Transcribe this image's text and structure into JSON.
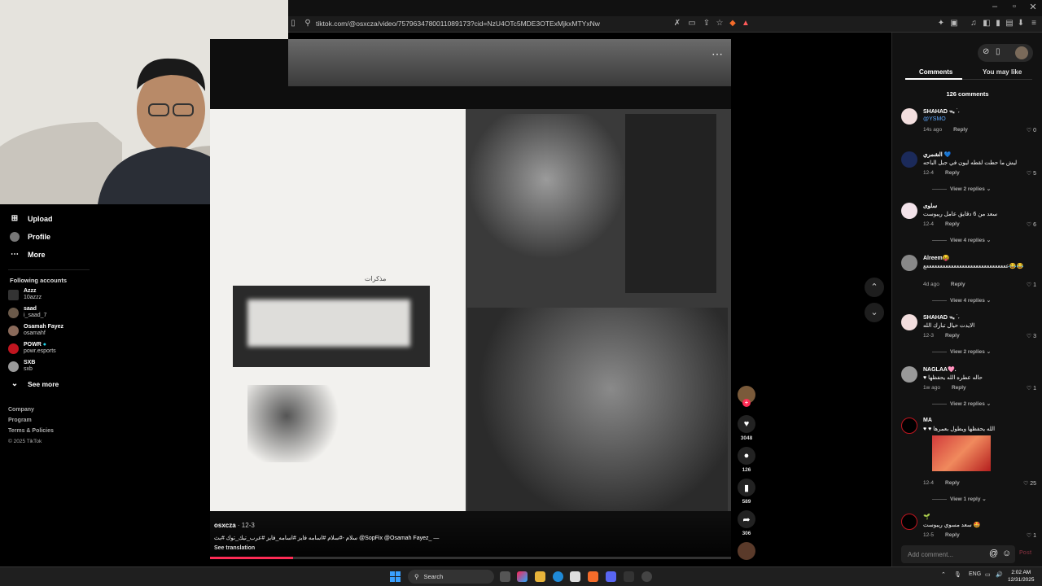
{
  "browser": {
    "url": "tiktok.com/@osxcza/video/7579634780011089173?cid=NzU4OTc5MDE3OTExMjkxMTYxNw",
    "window_controls": [
      "–",
      "▫",
      "✕"
    ]
  },
  "sidebar": {
    "nav": [
      {
        "label": "Upload",
        "icon": "plus-square-icon"
      },
      {
        "label": "Profile",
        "icon": "avatar-icon"
      },
      {
        "label": "More",
        "icon": "more-dots-icon"
      }
    ],
    "following_title": "Following accounts",
    "accounts": [
      {
        "name": "Azzz",
        "handle": "10azzz"
      },
      {
        "name": "saad",
        "handle": "i_saad_7"
      },
      {
        "name": "Osamah Fayez",
        "handle": "osamahf"
      },
      {
        "name": "POWR",
        "handle": "powr.esports",
        "verified": true
      },
      {
        "name": "SXB",
        "handle": "sxb"
      }
    ],
    "see_more": "See more",
    "footer": [
      "Company",
      "Program",
      "Terms & Policies",
      "© 2025 TikTok"
    ]
  },
  "video": {
    "author": "osxcza",
    "date": "· 12-3",
    "description": "سلام -#سلام #اسامه فايز #اسامه_فايز #عرب_تيك_توك #بث @SopFix @Osamah Fayez_ —",
    "see_translation": "See translation",
    "page_caption": "مذكرات",
    "progress": 0.16
  },
  "actions": {
    "likes": "3048",
    "comments": "126",
    "saves": "589",
    "shares": "306"
  },
  "panel": {
    "tabs": [
      "Comments",
      "You may like"
    ],
    "comments_count": "126 comments",
    "comments": [
      {
        "name": "SHAHAD ᯓ ࣪ ˖",
        "text": "@YSMO",
        "time": "14s ago",
        "likes": "0"
      },
      {
        "name": "الشمري 💙",
        "text": "ليش ما حطت لقطه ليون في جبل الباحه",
        "time": "12-4",
        "likes": "5",
        "replies": "View 2 replies"
      },
      {
        "name": "سلوى",
        "text": "سعد من 6 دقايق عامل ريبوست",
        "time": "12-4",
        "likes": "6",
        "replies": "View 4 replies"
      },
      {
        "name": "Alreem😝",
        "text": "ععععععععععععععععععععععععععععععع😂😂",
        "time": "4d ago",
        "likes": "1",
        "replies": "View 4 replies"
      },
      {
        "name": "SHAHAD ᯓ ࣪ ˖",
        "text": "الايدت حيال تبارك الله",
        "time": "12-3",
        "likes": "3",
        "replies": "View 2 replies"
      },
      {
        "name": "NAGLAA🩷.",
        "text": "♥ حاله عطره الله يحفظها",
        "time": "1w ago",
        "likes": "1",
        "replies": "View 2 replies"
      },
      {
        "name": "MA",
        "text": "♥ ♥ الله يحفظها ويطول بعمرها",
        "time": "12-4",
        "likes": "25",
        "replies": "View 1 reply"
      },
      {
        "name": "🌱",
        "text": "سعد مسوي ريبوست 🤩",
        "time": "12-5",
        "likes": "1"
      }
    ],
    "reply_label": "Reply",
    "add_comment_placeholder": "Add comment...",
    "post_label": "Post"
  },
  "taskbar": {
    "search_label": "Search",
    "lang": "ENG",
    "time": "2:02 AM",
    "date": "12/31/2025"
  }
}
